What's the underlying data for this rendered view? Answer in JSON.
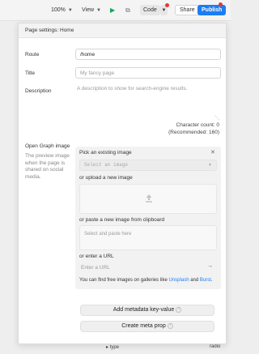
{
  "toolbar": {
    "zoom": "100%",
    "view_label": "View",
    "code_label": "Code",
    "share_label": "Share",
    "publish_label": "Publish",
    "colors": {
      "publish_bg": "#1d7df0",
      "notify_dot": "#e5393b",
      "play": "#1aa15a"
    }
  },
  "panel": {
    "title": "Page settings: Home",
    "route": {
      "label": "Route",
      "value": "/home"
    },
    "title_field": {
      "label": "Title",
      "placeholder": "My fancy page"
    },
    "description": {
      "label": "Description",
      "placeholder": "A description to show for search-engine results.",
      "char_count": "Character count: 0",
      "recommended": "(Recommended: 160)"
    },
    "og": {
      "label": "Open Graph image",
      "help": "The preview image when the page is shared on social media.",
      "pick_title": "Pick an existing image",
      "select_placeholder": "Select an image",
      "upload_title": "or upload a new image",
      "paste_title": "or paste a new image from clipboard",
      "paste_placeholder": "Select and paste here",
      "url_title": "or enter a URL",
      "url_placeholder": "Enter a URL",
      "note_prefix": "You can find free images on galleries like",
      "note_link1": "Unsplash",
      "note_and": "and",
      "note_link2": "Burst",
      "note_suffix": "."
    },
    "add_meta_label": "Add metadata key-value",
    "create_meta_label": "Create meta prop",
    "help_mark": "?"
  },
  "background": {
    "type_label": "type",
    "radio_label": "radio"
  }
}
